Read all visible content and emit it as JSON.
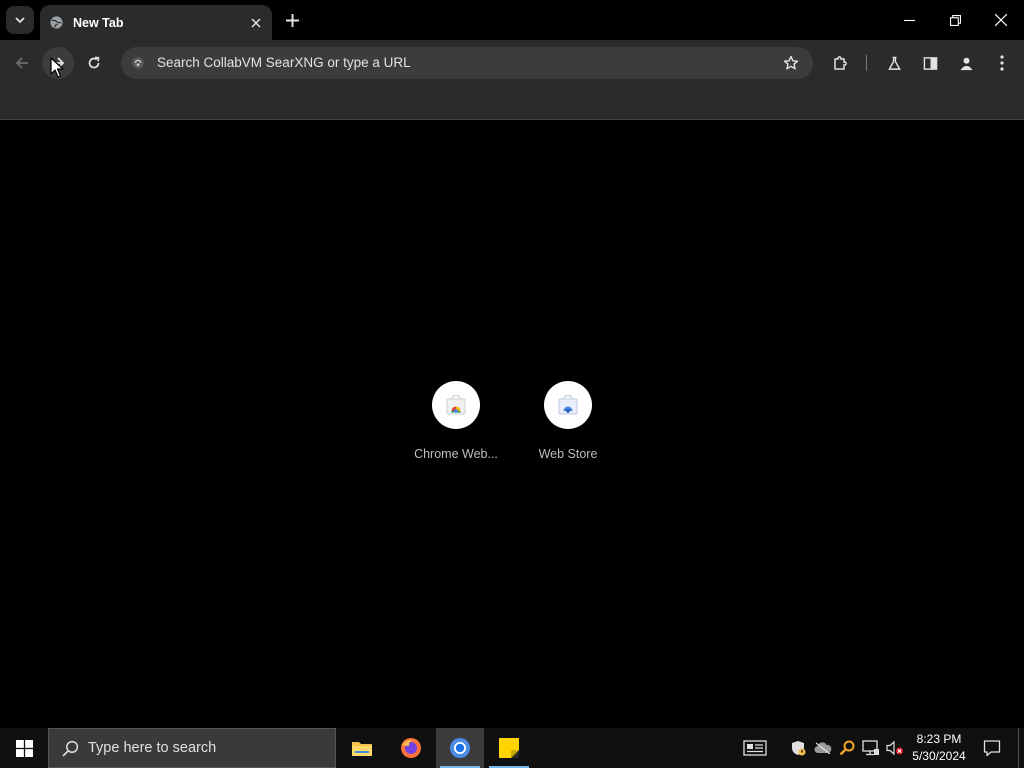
{
  "browser": {
    "tab": {
      "title": "New Tab"
    },
    "omnibox": {
      "placeholder": "Search CollabVM SearXNG or type a URL"
    }
  },
  "ntp": {
    "shortcuts": [
      {
        "label": "Chrome Web..."
      },
      {
        "label": "Web Store"
      }
    ]
  },
  "taskbar": {
    "search_placeholder": "Type here to search",
    "apps": [
      "file-explorer",
      "firefox",
      "chrome",
      "sticky-notes"
    ],
    "clock": {
      "time": "8:23 PM",
      "date": "5/30/2024"
    }
  },
  "colors": {
    "tab_bg": "#2b2b2b",
    "omnibox_bg": "#3c3c3c",
    "taskbar_bg": "#101010",
    "accent": "#76b9ed"
  }
}
